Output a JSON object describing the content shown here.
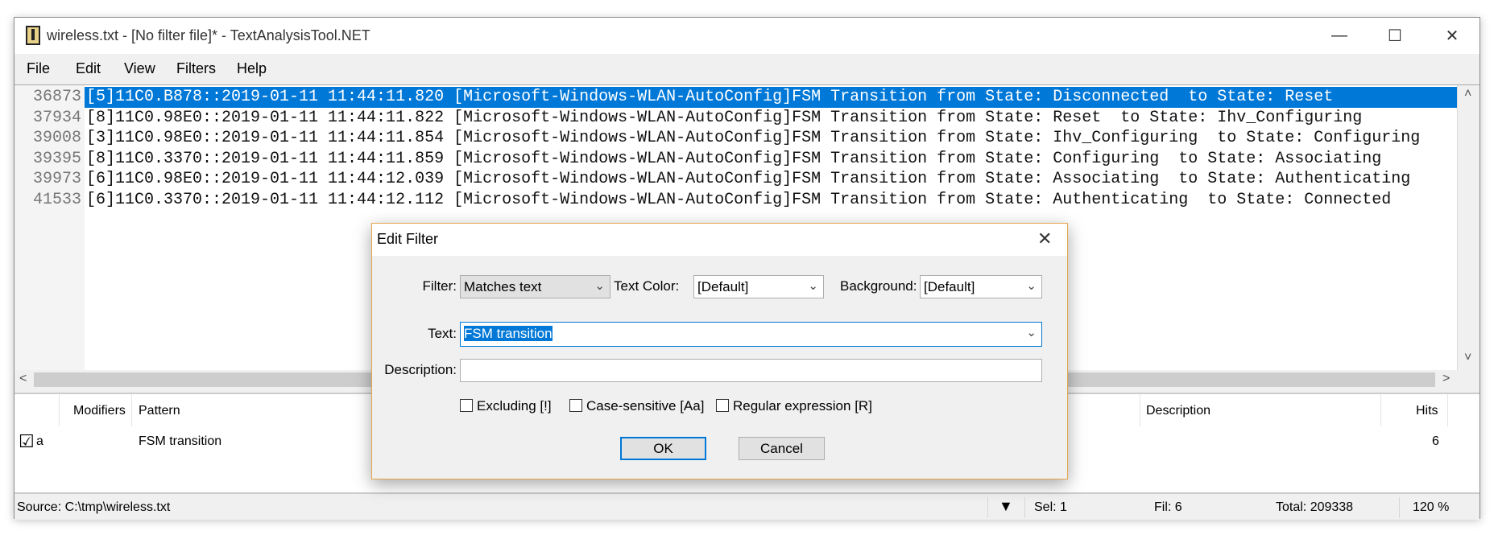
{
  "window": {
    "title": "wireless.txt - [No filter file]* - TextAnalysisTool.NET",
    "minimize": "—",
    "maximize": "☐",
    "close": "✕"
  },
  "menu": [
    "File",
    "Edit",
    "View",
    "Filters",
    "Help"
  ],
  "lines": [
    {
      "num": "36873",
      "text": "[5]11C0.B878::2019-01-11 11:44:11.820 [Microsoft-Windows-WLAN-AutoConfig]FSM Transition from State: Disconnected  to State: Reset",
      "selected": true
    },
    {
      "num": "37934",
      "text": "[8]11C0.98E0::2019-01-11 11:44:11.822 [Microsoft-Windows-WLAN-AutoConfig]FSM Transition from State: Reset  to State: Ihv_Configuring"
    },
    {
      "num": "39008",
      "text": "[3]11C0.98E0::2019-01-11 11:44:11.854 [Microsoft-Windows-WLAN-AutoConfig]FSM Transition from State: Ihv_Configuring  to State: Configuring"
    },
    {
      "num": "39395",
      "text": "[8]11C0.3370::2019-01-11 11:44:11.859 [Microsoft-Windows-WLAN-AutoConfig]FSM Transition from State: Configuring  to State: Associating"
    },
    {
      "num": "39973",
      "text": "[6]11C0.98E0::2019-01-11 11:44:12.039 [Microsoft-Windows-WLAN-AutoConfig]FSM Transition from State: Associating  to State: Authenticating"
    },
    {
      "num": "41533",
      "text": "[6]11C0.3370::2019-01-11 11:44:12.112 [Microsoft-Windows-WLAN-AutoConfig]FSM Transition from State: Authenticating  to State: Connected"
    }
  ],
  "scroll": {
    "up": "˄",
    "down": "˅",
    "left": "<",
    "right": ">"
  },
  "filters": {
    "headers": {
      "modifiers": "Modifiers",
      "pattern": "Pattern",
      "description": "Description",
      "hits": "Hits"
    },
    "rows": [
      {
        "checked": "☑",
        "modifiers": "a",
        "pattern": "FSM transition",
        "description": "",
        "hits": "6"
      }
    ]
  },
  "status": {
    "source": "Source: C:\\tmp\\wireless.txt",
    "filter_icon": "▼",
    "sel": "Sel: 1",
    "fil": "Fil: 6",
    "total": "Total: 209338",
    "zoom": "120 %"
  },
  "dialog": {
    "title": "Edit Filter",
    "close": "✕",
    "filter_label": "Filter:",
    "filter_value": "Matches text",
    "text_color_label": "Text Color:",
    "text_color_value": "[Default]",
    "background_label": "Background:",
    "background_value": "[Default]",
    "text_label": "Text:",
    "text_value": "FSM transition",
    "description_label": "Description:",
    "description_value": "",
    "excluding": "Excluding [!]",
    "case_sensitive": "Case-sensitive [Aa]",
    "regex": "Regular expression [R]",
    "ok": "OK",
    "cancel": "Cancel",
    "chevron": "⌄"
  },
  "colors": {
    "selection": "#0078d7",
    "dialog_border": "#e5a54a"
  }
}
